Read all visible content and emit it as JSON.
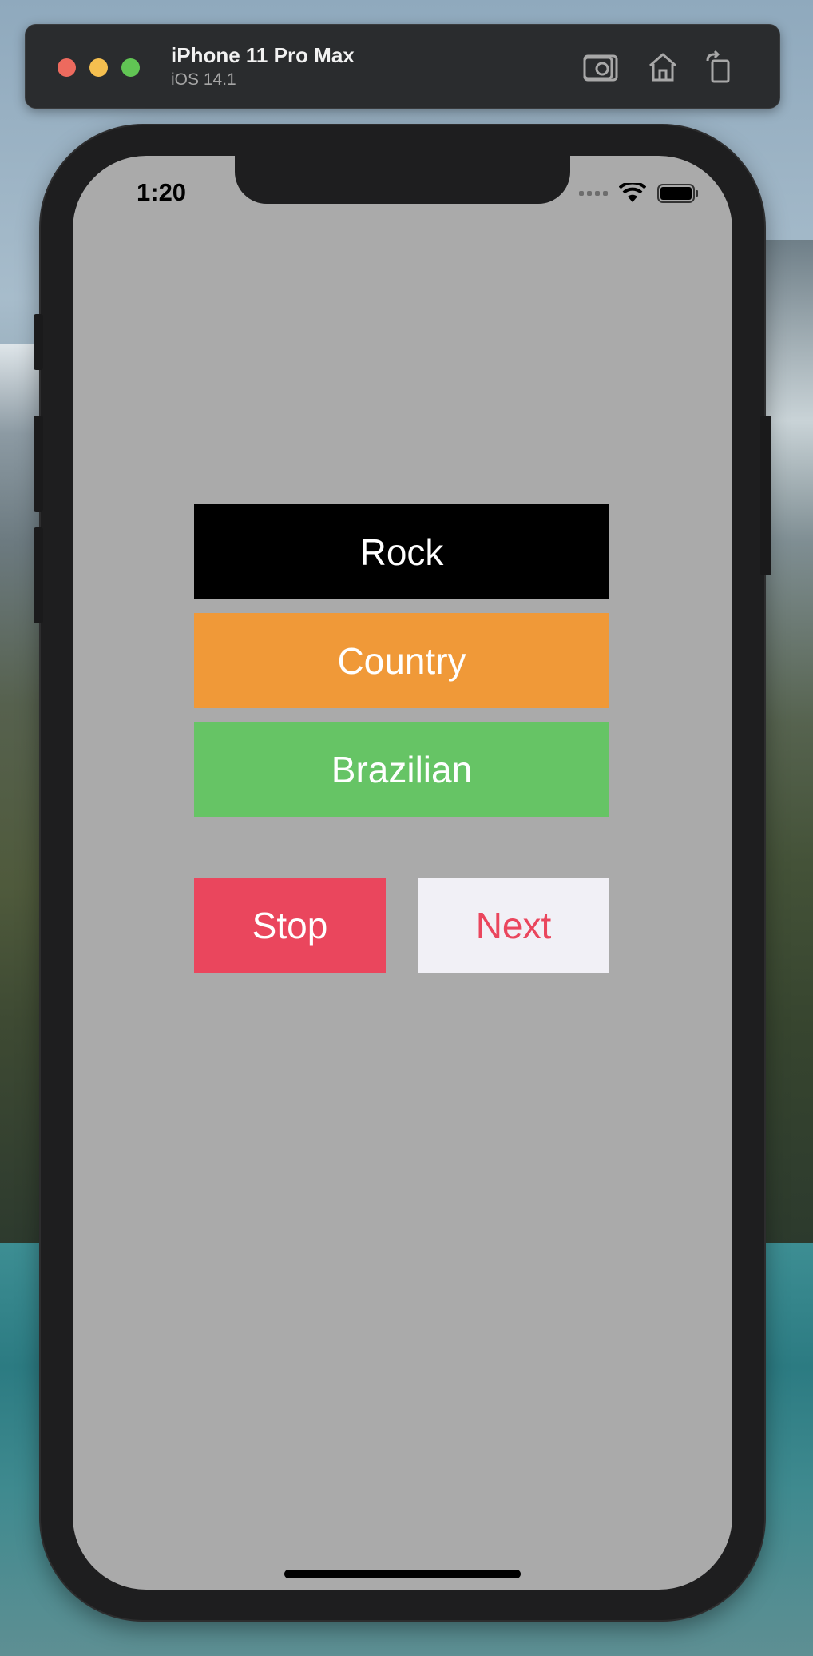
{
  "simulator": {
    "device_name": "iPhone 11 Pro Max",
    "os_version": "iOS 14.1",
    "toolbar_icons": [
      "camera-icon",
      "home-icon",
      "rotate-icon"
    ]
  },
  "status_bar": {
    "time": "1:20"
  },
  "genres": [
    {
      "label": "Rock",
      "color": "#000000"
    },
    {
      "label": "Country",
      "color": "#f09938"
    },
    {
      "label": "Brazilian",
      "color": "#66c465"
    }
  ],
  "controls": {
    "stop": {
      "label": "Stop",
      "background": "#ea465d",
      "text_color": "#ffffff"
    },
    "next": {
      "label": "Next",
      "background": "#f1f0f6",
      "text_color": "#ea465d"
    }
  },
  "colors": {
    "screen_background": "#aaaaaa"
  }
}
